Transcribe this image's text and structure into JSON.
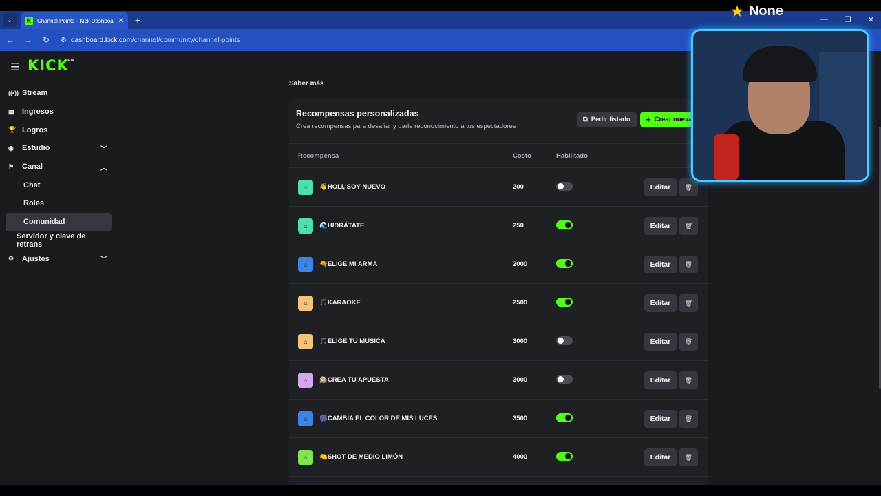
{
  "browser": {
    "tab_title": "Channel Points - Kick Dashboar",
    "url_domain": "dashboard.kick.com",
    "url_path": "/channel/community/channel-points"
  },
  "overlay": {
    "label": "None"
  },
  "sidebar": {
    "logo": "KICK",
    "logo_badge": "BETA",
    "items": [
      {
        "label": "Stream",
        "icon": "stream-icon"
      },
      {
        "label": "Ingresos",
        "icon": "revenue-icon"
      },
      {
        "label": "Logros",
        "icon": "trophy-icon"
      },
      {
        "label": "Estudio",
        "icon": "studio-icon"
      },
      {
        "label": "Canal",
        "icon": "channel-icon"
      },
      {
        "label": "Chat"
      },
      {
        "label": "Roles"
      },
      {
        "label": "Comunidad"
      },
      {
        "label": "Servidor y clave de retrans"
      },
      {
        "label": "Ajustes",
        "icon": "settings-icon"
      }
    ]
  },
  "main": {
    "learn_more": "Saber más",
    "card": {
      "title": "Recompensas personalizadas",
      "subtitle": "Crea recompensas para desafiar y darle reconocimiento a tus espectadores",
      "request_list_label": "Pedir listado",
      "create_label": "Crear nueva"
    },
    "table": {
      "headers": [
        "Recompensa",
        "Costo",
        "Habilitado"
      ],
      "edit_label": "Editar",
      "rows": [
        {
          "name": "👋HOLI, SOY NUEVO",
          "cost": "200",
          "enabled": false,
          "color": "#4ddfb0"
        },
        {
          "name": "🌊HIDRÁTATE",
          "cost": "250",
          "enabled": true,
          "color": "#4ddfb0"
        },
        {
          "name": "🔫ELIGE MI ARMA",
          "cost": "2000",
          "enabled": true,
          "color": "#3a86e8"
        },
        {
          "name": "🎵KARAOKE",
          "cost": "2500",
          "enabled": true,
          "color": "#f5c27a"
        },
        {
          "name": "🎵ELIGE TU MÚSICA",
          "cost": "3000",
          "enabled": false,
          "color": "#f5c27a"
        },
        {
          "name": "🎰CREA TU APUESTA",
          "cost": "3000",
          "enabled": false,
          "color": "#d7a4f0"
        },
        {
          "name": "🎆CAMBIA EL COLOR DE MIS LUCES",
          "cost": "3500",
          "enabled": true,
          "color": "#3a86e8"
        },
        {
          "name": "🍋SHOT DE MEDIO LIMÓN",
          "cost": "4000",
          "enabled": true,
          "color": "#7ee64e"
        }
      ]
    }
  }
}
